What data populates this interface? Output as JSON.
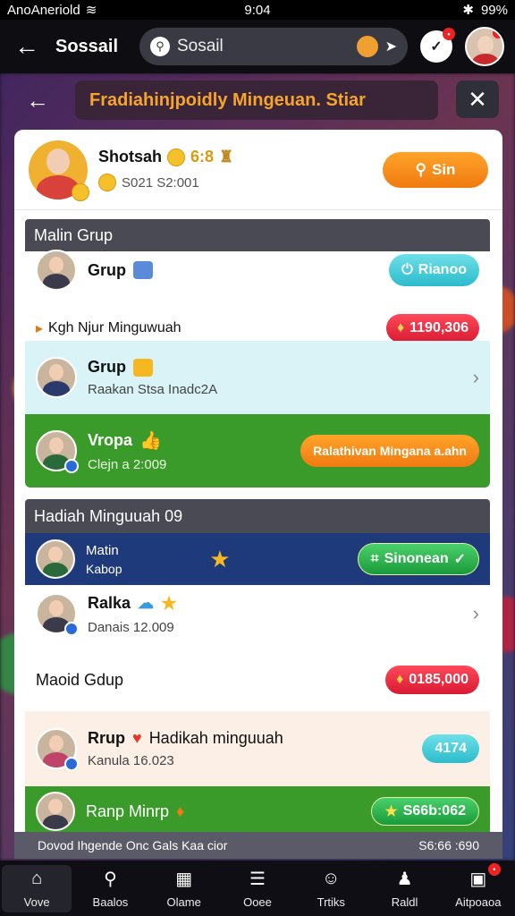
{
  "status_bar": {
    "carrier": "AnoAneriold",
    "time": "9:04",
    "battery": "99%"
  },
  "header": {
    "title": "Sossail",
    "search_value": "Sosail"
  },
  "dialog": {
    "title": "Fradiahinjpoidly Mingeuan. Stiar"
  },
  "profile": {
    "name": "Shotsah",
    "score": "6:8",
    "sub": "S021 S2:001",
    "button": "Sin"
  },
  "section1": {
    "head": "Malin Grup",
    "row1": {
      "title": "Grup",
      "button": "Rianoo",
      "sub": "Kgh Njur Minguwuah",
      "amount": "1190,306"
    },
    "row2": {
      "title": "Grup",
      "sub": "Raakan Stsa Inadc2A"
    },
    "row3": {
      "title": "Vropa",
      "sub": "Clejn a 2:009",
      "button": "Ralathivan Mingana a.ahn"
    }
  },
  "section2": {
    "head": "Hadiah Minguuah 09",
    "row1": {
      "title": "Matin",
      "sub": "Kabop",
      "button": "Sinonean"
    },
    "row2": {
      "title": "Ralka",
      "sub": "Danais 12.009",
      "label": "Maoid Gdup",
      "amount": "0185,000"
    },
    "row3": {
      "title": "Rrup",
      "title2": "Hadikah minguuah",
      "sub": "Kanula 16.023",
      "badge": "4174"
    },
    "row4": {
      "title": "Ranp Minrp",
      "button": "S66b:062"
    }
  },
  "bottom_strip": {
    "left": "Dovod Ihgende Onc Gals Kaa cior",
    "right": "S6:66 :690"
  },
  "tabs": [
    {
      "label": "Vove"
    },
    {
      "label": "Baalos"
    },
    {
      "label": "Olame"
    },
    {
      "label": "Ooee"
    },
    {
      "label": "Trtiks"
    },
    {
      "label": "Raldl"
    },
    {
      "label": "Aitpoaoa"
    }
  ],
  "colors": {
    "accent_orange": "#f07a10",
    "teal": "#2bbccc",
    "red": "#d81a32",
    "green_band": "#3a9a2a",
    "navy_band": "#1f3a7a"
  }
}
